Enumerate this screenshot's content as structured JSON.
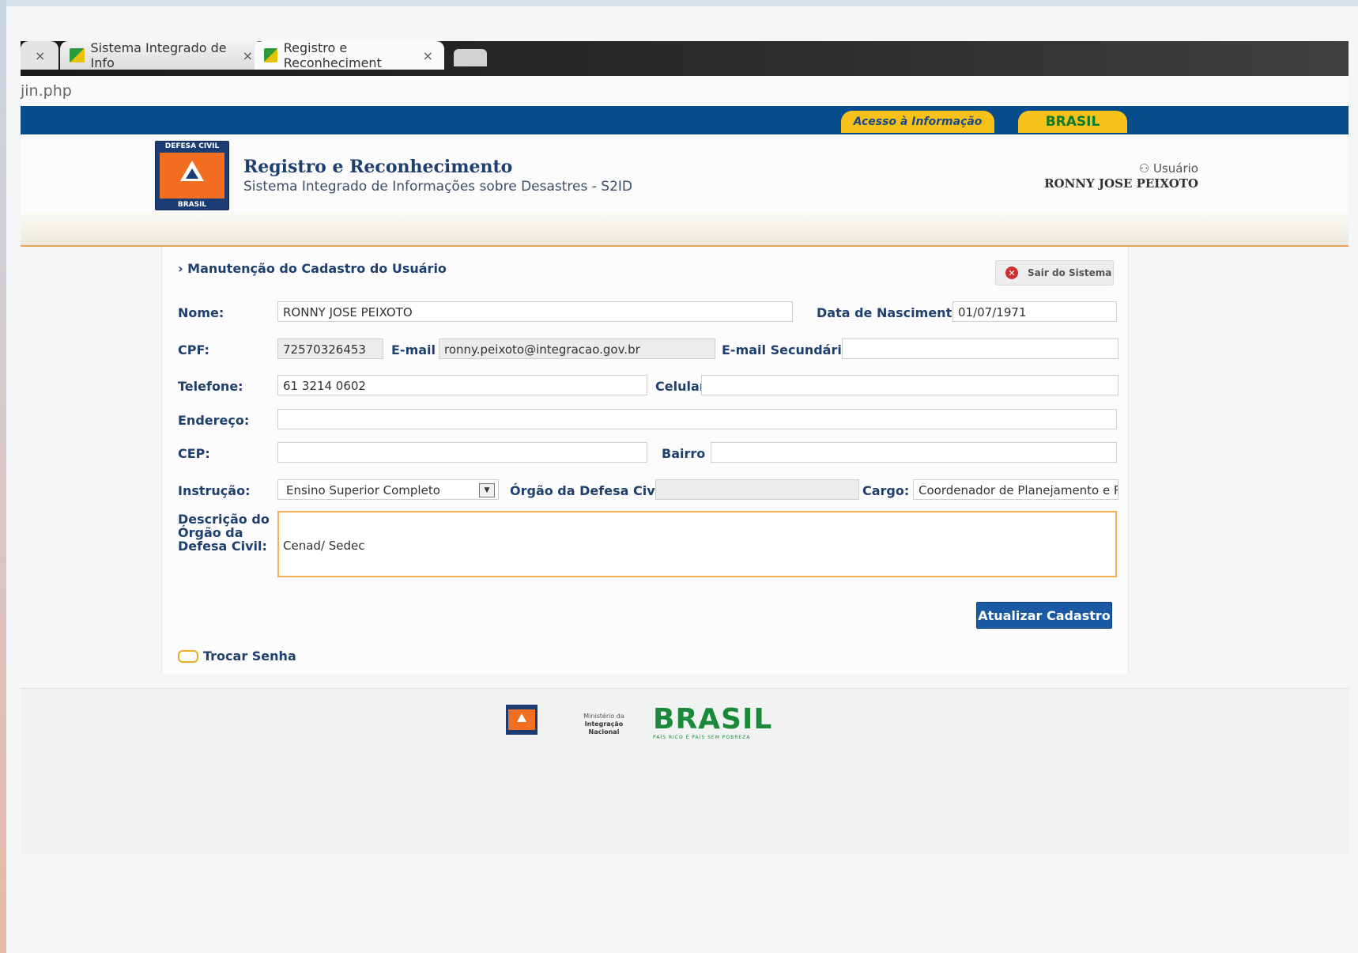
{
  "browser": {
    "tabs": [
      {
        "label": "Sistema Integrado de Info"
      },
      {
        "label": "Registro e Reconheciment"
      }
    ],
    "close_glyph": "×",
    "url_fragment": "jin.php"
  },
  "govbar": {
    "acesso": "Acesso à Informação",
    "brasil": "BRASIL"
  },
  "header": {
    "logo_top": "DEFESA CIVIL",
    "logo_bottom": "BRASIL",
    "title": "Registro e Reconhecimento",
    "subtitle": "Sistema Integrado de Informações sobre Desastres - S2ID",
    "user_label": "Usuário",
    "user_name": "RONNY JOSE PEIXOTO"
  },
  "page": {
    "section_title": "› Manutenção do Cadastro do Usuário",
    "logout_label": "Sair do Sistema",
    "submit_label": "Atualizar Cadastro",
    "change_password_label": "Trocar Senha"
  },
  "form": {
    "nome_label": "Nome:",
    "nome_value": "RONNY JOSE PEIXOTO",
    "nascimento_label": "Data de Nascimento",
    "nascimento_value": "01/07/1971",
    "cpf_label": "CPF:",
    "cpf_value": "72570326453",
    "email_label": "E-mail",
    "email_value": "ronny.peixoto@integracao.gov.br",
    "email2_label": "E-mail Secundário",
    "email2_value": "",
    "telefone_label": "Telefone:",
    "telefone_value": "61 3214 0602",
    "celular_label": "Celular",
    "celular_value": "",
    "endereco_label": "Endereço:",
    "endereco_value": "",
    "cep_label": "CEP:",
    "cep_value": "",
    "bairro_label": "Bairro",
    "bairro_value": "",
    "instrucao_label": "Instrução:",
    "instrucao_value": "Ensino Superior Completo",
    "orgao_label": "Órgão da Defesa Civil:",
    "orgao_value": "",
    "cargo_label": "Cargo:",
    "cargo_value": "Coordenador de Planejamento e Re",
    "descricao_label": "Descrição do Órgão da Defesa Civil:",
    "descricao_value": "Cenad/ Sedec"
  },
  "footer": {
    "ministerio_line1": "Ministério da",
    "ministerio_line2": "Integração Nacional",
    "brasil": "BRASIL",
    "brasil_tagline": "PAÍS RICO É PAÍS SEM POBREZA"
  },
  "colors": {
    "gov_blue": "#084b8a",
    "accent_orange": "#f26f21",
    "button_blue": "#1a5aa4",
    "label_blue": "#1f3f6e"
  }
}
